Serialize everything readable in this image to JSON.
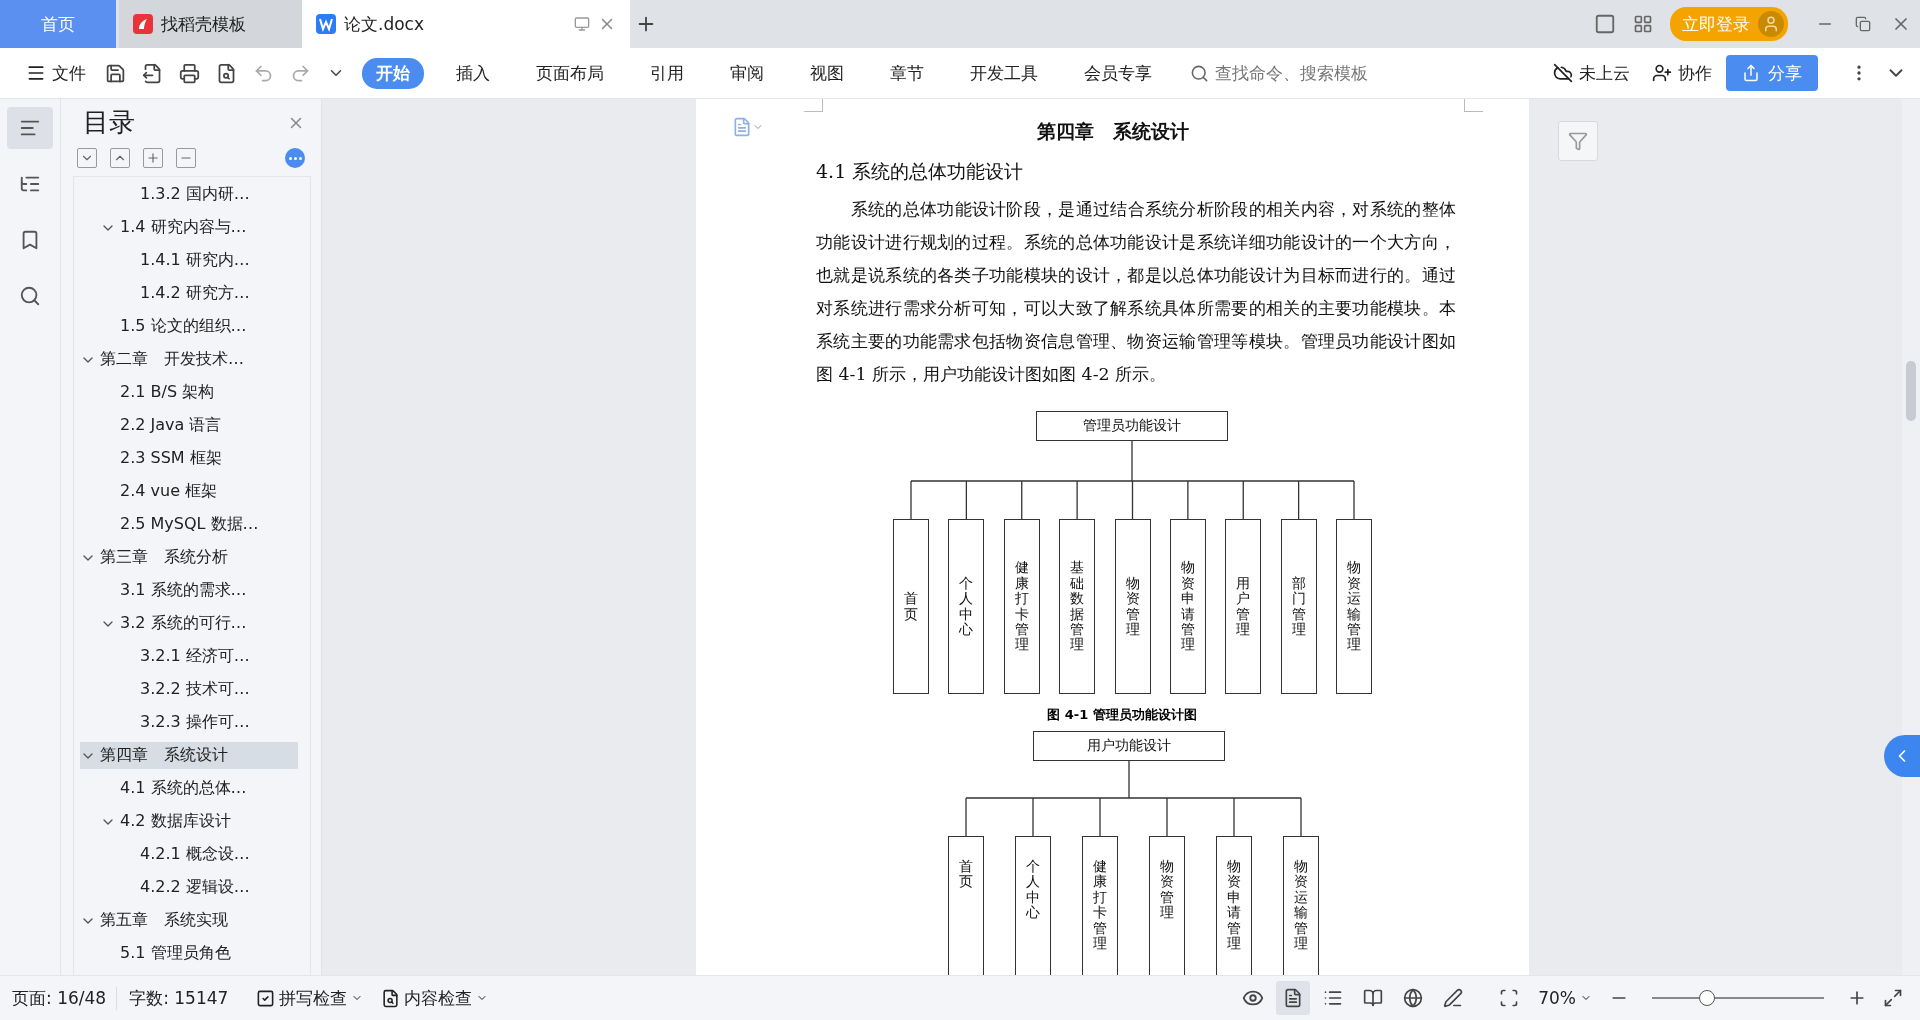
{
  "tabs": [
    {
      "label": "首页",
      "kind": "home",
      "selected": false
    },
    {
      "label": "找稻壳模板",
      "kind": "store",
      "selected": false
    },
    {
      "label": "论文.docx",
      "kind": "doc",
      "selected": true
    }
  ],
  "login_button": "立即登录",
  "toolbar": {
    "file_menu": "文件",
    "ribbon_tabs": [
      {
        "label": "开始",
        "selected": true
      },
      {
        "label": "插入",
        "selected": false
      },
      {
        "label": "页面布局",
        "selected": false
      },
      {
        "label": "引用",
        "selected": false
      },
      {
        "label": "审阅",
        "selected": false
      },
      {
        "label": "视图",
        "selected": false
      },
      {
        "label": "章节",
        "selected": false
      },
      {
        "label": "开发工具",
        "selected": false
      },
      {
        "label": "会员专享",
        "selected": false
      }
    ],
    "search": {
      "placeholder": "查找命令、搜索模板"
    },
    "cloud": "未上云",
    "collab": "协作",
    "share": "分享"
  },
  "toc": {
    "title": "目录",
    "items": [
      {
        "children": [
          {
            "children": [
              {
                "label": "1.3.2 国内研…",
                "selected": false
              }
            ]
          },
          {
            "label": "1.4 研究内容与…",
            "selected": false,
            "expanded": true,
            "children": [
              {
                "label": "1.4.1 研究内…",
                "selected": false
              },
              {
                "label": "1.4.2 研究方…",
                "selected": false
              }
            ]
          },
          {
            "label": "1.5 论文的组织…",
            "selected": false
          }
        ]
      },
      {
        "label": "第二章　开发技术…",
        "selected": false,
        "expanded": true,
        "children": [
          {
            "label": "2.1 B/S 架构",
            "selected": false
          },
          {
            "label": "2.2 Java 语言",
            "selected": false
          },
          {
            "label": "2.3 SSM 框架",
            "selected": false
          },
          {
            "label": "2.4 vue 框架",
            "selected": false
          },
          {
            "label": "2.5 MySQL 数据…",
            "selected": false
          }
        ]
      },
      {
        "label": "第三章　系统分析",
        "selected": false,
        "expanded": true,
        "children": [
          {
            "label": "3.1 系统的需求…",
            "selected": false
          },
          {
            "label": "3.2 系统的可行…",
            "selected": false,
            "expanded": true,
            "children": [
              {
                "label": "3.2.1 经济可…",
                "selected": false
              },
              {
                "label": "3.2.2 技术可…",
                "selected": false
              },
              {
                "label": "3.2.3 操作可…",
                "selected": false
              }
            ]
          }
        ]
      },
      {
        "label": "第四章　系统设计",
        "selected": true,
        "expanded": true,
        "children": [
          {
            "label": "4.1 系统的总体…",
            "selected": false
          },
          {
            "label": "4.2 数据库设计",
            "selected": false,
            "expanded": true,
            "children": [
              {
                "label": "4.2.1 概念设…",
                "selected": false
              },
              {
                "label": "4.2.2 逻辑设…",
                "selected": false
              }
            ]
          }
        ]
      },
      {
        "label": "第五章　系统实现",
        "selected": false,
        "expanded": true,
        "children": [
          {
            "label": "5.1 管理员角色",
            "selected": false
          }
        ]
      }
    ]
  },
  "document": {
    "chapter_title": "第四章　系统设计",
    "section_title": "4.1 系统的总体功能设计",
    "paragraph": "系统的总体功能设计阶段，是通过结合系统分析阶段的相关内容，对系统的整体功能设计进行规划的过程。系统的总体功能设计是系统详细功能设计的一个大方向，也就是说系统的各类子功能模块的设计，都是以总体功能设计为目标而进行的。通过对系统进行需求分析可知，可以大致了解系统具体所需要的相关的主要功能模块。本系统主要的功能需求包括物资信息管理、物资运输管理等模块。管理员功能设计图如图 4-1 所示，用户功能设计图如图 4-2 所示。",
    "diagrams": [
      {
        "root": "管理员功能设计",
        "children": [
          "首页",
          "个人中心",
          "健康打卡管理",
          "基础数据管理",
          "物资管理",
          "物资申请管理",
          "用户管理",
          "部门管理",
          "物资运输管理"
        ],
        "caption": "图 4-1 管理员功能设计图"
      },
      {
        "root": "用户功能设计",
        "children": [
          "首页",
          "个人中心",
          "健康打卡管理",
          "物资管理",
          "物资申请管理",
          "物资运输管理"
        ]
      }
    ]
  },
  "status_bar": {
    "page": "页面: 16/48",
    "words": "字数: 15147",
    "spell_check": "拼写检查",
    "content_check": "内容检查",
    "zoom": "70%",
    "zoom_level": {
      "level": 0.32
    }
  }
}
